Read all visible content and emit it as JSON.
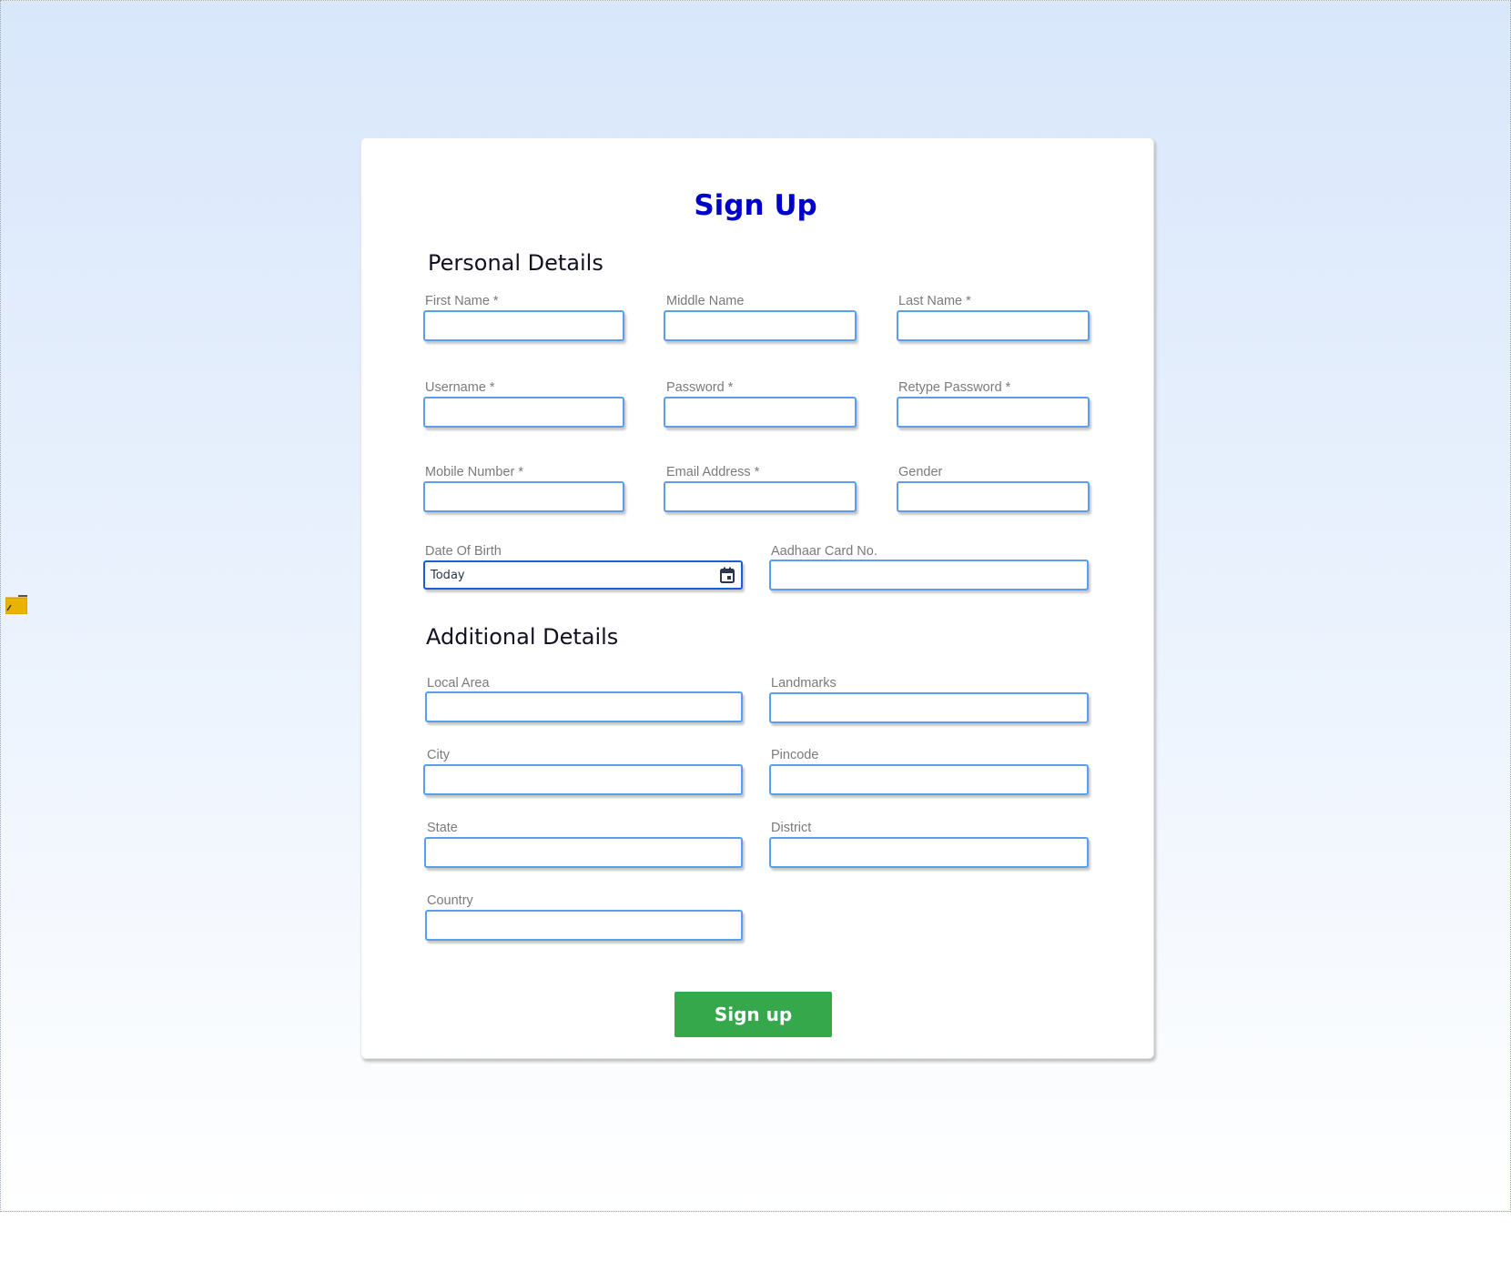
{
  "title": "Sign Up",
  "personal": {
    "heading": "Personal Details",
    "fields": [
      {
        "label": "First Name *",
        "value": ""
      },
      {
        "label": "Middle Name",
        "value": ""
      },
      {
        "label": "Last Name *",
        "value": ""
      },
      {
        "label": "Username *",
        "value": ""
      },
      {
        "label": "Password *",
        "value": ""
      },
      {
        "label": "Retype Password *",
        "value": ""
      },
      {
        "label": "Mobile Number *",
        "value": ""
      },
      {
        "label": "Email Address *",
        "value": ""
      },
      {
        "label": "Gender",
        "value": ""
      },
      {
        "label": "Date Of Birth",
        "value": "Today",
        "icon": "calendar-icon"
      },
      {
        "label": "Aadhaar Card No.",
        "value": ""
      }
    ]
  },
  "additional": {
    "heading": "Additional Details",
    "fields": [
      {
        "label": "Local Area",
        "value": ""
      },
      {
        "label": "Landmarks",
        "value": ""
      },
      {
        "label": "City",
        "value": ""
      },
      {
        "label": "Pincode",
        "value": ""
      },
      {
        "label": "State",
        "value": ""
      },
      {
        "label": "District",
        "value": ""
      },
      {
        "label": "Country",
        "value": ""
      }
    ]
  },
  "submit_label": "Sign up",
  "colors": {
    "title": "#0000cc",
    "button": "#34a84a",
    "input_border": "#5a9ef2"
  },
  "side_icon": "folder-edit-icon"
}
